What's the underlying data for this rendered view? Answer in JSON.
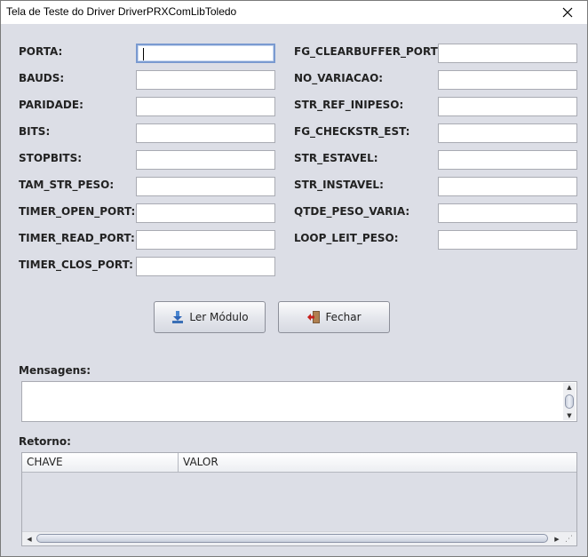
{
  "window": {
    "title": "Tela de Teste do Driver DriverPRXComLibToledo"
  },
  "left_fields": [
    {
      "label": "PORTA:",
      "value": ""
    },
    {
      "label": "BAUDS:",
      "value": ""
    },
    {
      "label": "PARIDADE:",
      "value": ""
    },
    {
      "label": "BITS:",
      "value": ""
    },
    {
      "label": "STOPBITS:",
      "value": ""
    },
    {
      "label": "TAM_STR_PESO:",
      "value": ""
    },
    {
      "label": "TIMER_OPEN_PORT:",
      "value": ""
    },
    {
      "label": "TIMER_READ_PORT:",
      "value": ""
    },
    {
      "label": "TIMER_CLOS_PORT:",
      "value": ""
    }
  ],
  "right_fields": [
    {
      "label": "FG_CLEARBUFFER_PORT:",
      "value": ""
    },
    {
      "label": "NO_VARIACAO:",
      "value": ""
    },
    {
      "label": "STR_REF_INIPESO:",
      "value": ""
    },
    {
      "label": "FG_CHECKSTR_EST:",
      "value": ""
    },
    {
      "label": "STR_ESTAVEL:",
      "value": ""
    },
    {
      "label": "STR_INSTAVEL:",
      "value": ""
    },
    {
      "label": "QTDE_PESO_VARIA:",
      "value": ""
    },
    {
      "label": "LOOP_LEIT_PESO:",
      "value": ""
    }
  ],
  "buttons": {
    "read": {
      "label": "Ler Módulo",
      "icon": "download-icon"
    },
    "close": {
      "label": "Fechar",
      "icon": "exit-icon"
    }
  },
  "messages": {
    "label": "Mensagens:",
    "value": ""
  },
  "result": {
    "label": "Retorno:",
    "columns": [
      "CHAVE",
      "VALOR"
    ],
    "rows": []
  }
}
